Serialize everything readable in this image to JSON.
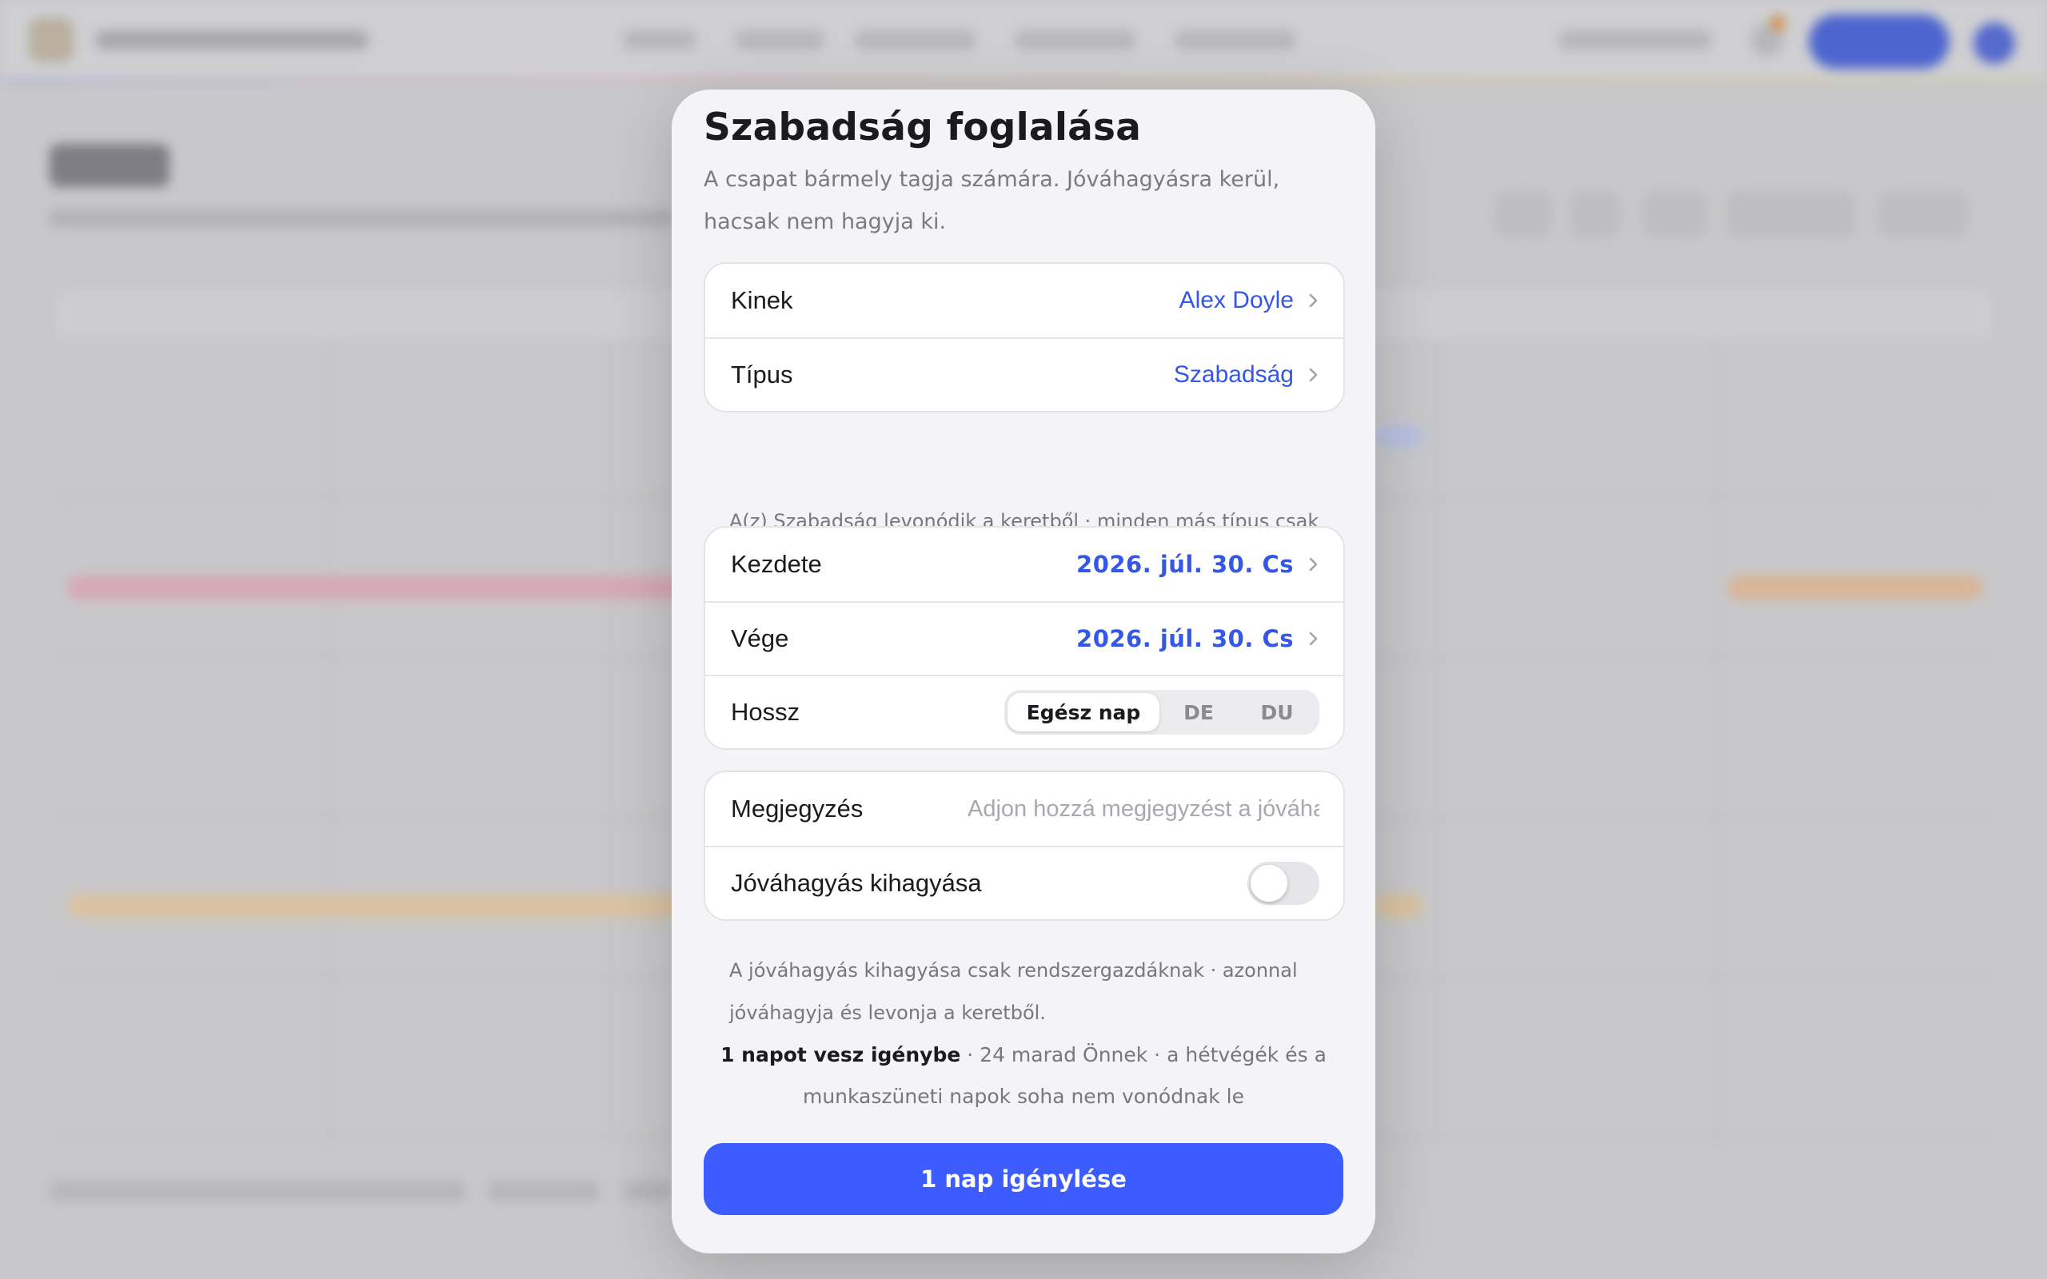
{
  "modal": {
    "title": "Szabadság foglalása",
    "description": "A csapat bármely tagja számára. Jóváhagyásra kerül, hacsak nem hagyja ki."
  },
  "who_type": {
    "who_label": "Kinek",
    "who_value": "Alex Doyle",
    "type_label": "Típus",
    "type_value": "Szabadság",
    "hint": "A(z) Szabadság levonódik a keretből · minden más típus csak rögzítésre kerül."
  },
  "dates": {
    "start_label": "Kezdete",
    "start_value": "2026. júl. 30. Cs",
    "end_label": "Vége",
    "end_value": "2026. júl. 30. Cs",
    "length_label": "Hossz",
    "length_options": [
      "Egész nap",
      "DE",
      "DU"
    ],
    "length_selected": "Egész nap"
  },
  "note": {
    "note_label": "Megjegyzés",
    "note_placeholder": "Adjon hozzá megjegyzést a jóváhagyónak",
    "note_value": "",
    "skip_label": "Jóváhagyás kihagyása",
    "skip_enabled": false,
    "hint": "A jóváhagyás kihagyása csak rendszergazdáknak · azonnal jóváhagyja és levonja a keretből."
  },
  "summary": {
    "strong": "1 napot vesz igénybe",
    "rest": " · 24 marad Önnek · a hétvégék és a munkaszüneti napok soha nem vonódnak le"
  },
  "submit_label": "1 nap igénylése",
  "colors": {
    "accent": "#3457e6",
    "button": "#3d5cff",
    "modal_bg": "#f4f4f6"
  },
  "icons": {
    "row_chevron": "chevron-right-icon"
  }
}
